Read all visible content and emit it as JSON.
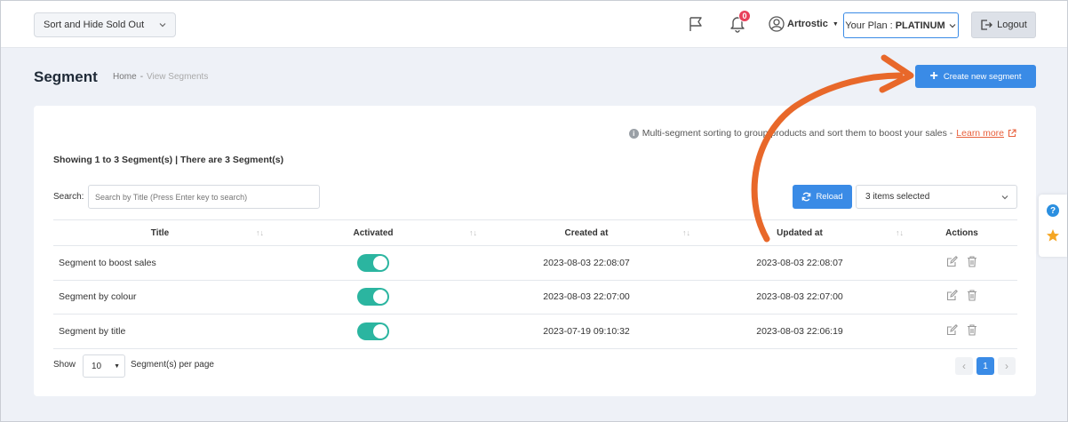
{
  "topbar": {
    "sort_select": "Sort and Hide Sold Out",
    "notifications_count": "0",
    "user_name": "Artrostic",
    "plan_label": "Your Plan :",
    "plan_value": "PLATINUM",
    "logout_label": "Logout"
  },
  "header": {
    "title": "Segment",
    "breadcrumb_home": "Home",
    "breadcrumb_sep": "-",
    "breadcrumb_current": "View Segments",
    "create_button": "Create new segment"
  },
  "card": {
    "info_text": "Multi-segment sorting to group products and sort them to boost your sales -",
    "learn_more": "Learn more",
    "showing": "Showing 1 to 3 Segment(s) | There are 3 Segment(s)",
    "search_label": "Search:",
    "search_placeholder": "Search by Title (Press Enter key to search)",
    "reload_label": "Reload",
    "columns_select": "3 items selected"
  },
  "table": {
    "headers": {
      "title": "Title",
      "activated": "Activated",
      "created_at": "Created at",
      "updated_at": "Updated at",
      "actions": "Actions"
    },
    "rows": [
      {
        "title": "Segment to boost sales",
        "activated": true,
        "created_at": "2023-08-03 22:08:07",
        "updated_at": "2023-08-03 22:08:07"
      },
      {
        "title": "Segment by colour",
        "activated": true,
        "created_at": "2023-08-03 22:07:00",
        "updated_at": "2023-08-03 22:07:00"
      },
      {
        "title": "Segment by title",
        "activated": true,
        "created_at": "2023-07-19 09:10:32",
        "updated_at": "2023-08-03 22:06:19"
      }
    ]
  },
  "footer": {
    "show_label": "Show",
    "page_size": "10",
    "per_page_label": "Segment(s) per page",
    "current_page": "1"
  },
  "colors": {
    "primary": "#3a8be6",
    "toggle_on": "#2bb5a0",
    "badge": "#e8405a",
    "arrow": "#e8682a",
    "link": "#e8603c"
  }
}
